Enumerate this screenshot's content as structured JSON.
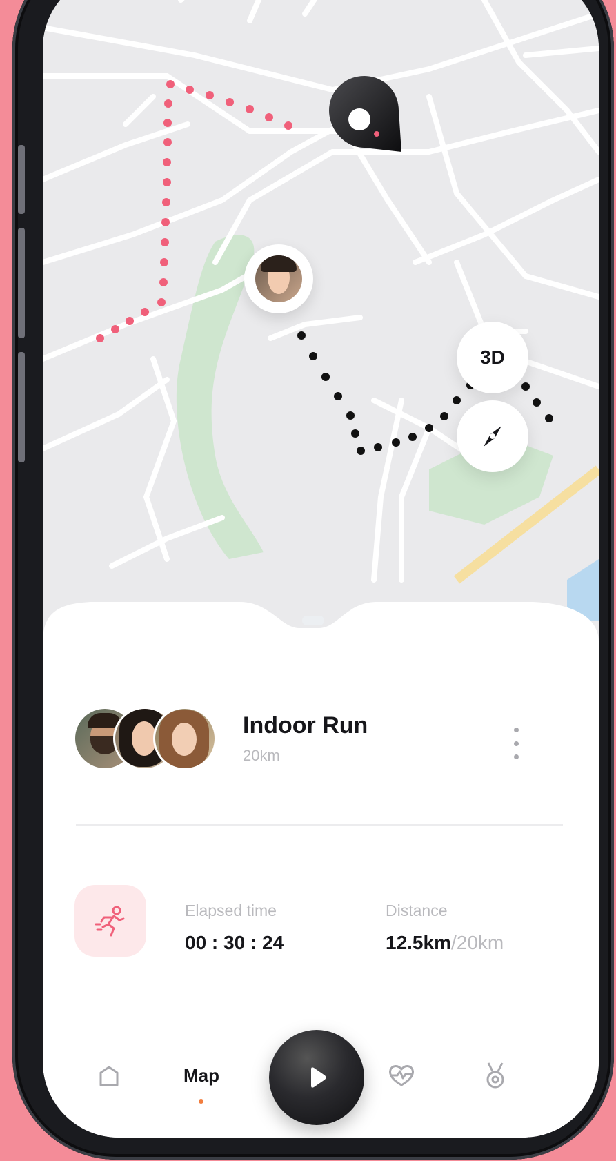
{
  "map": {
    "controls": {
      "view_3d_label": "3D",
      "compass_icon": "compass-icon"
    },
    "route_color_start": "#f0607a",
    "route_color_current": "#111111"
  },
  "activity": {
    "title": "Indoor Run",
    "distance_goal": "20km",
    "more_icon": "more-vertical-icon",
    "participants_count": 3
  },
  "stats": {
    "activity_icon": "running-icon",
    "elapsed_label": "Elapsed time",
    "elapsed_value": "00 : 30 : 24",
    "distance_label": "Distance",
    "distance_current": "12.5km",
    "distance_total": "/20km"
  },
  "nav": {
    "home_icon": "home-icon",
    "map_label": "Map",
    "play_icon": "play-icon",
    "health_icon": "heart-pulse-icon",
    "achievements_icon": "medal-icon",
    "active_indicator_color": "#f27d3e"
  },
  "colors": {
    "accent": "#f0607a",
    "background": "#f48c98",
    "park": "#cfe6cf",
    "road_highlight": "#f6dfa0"
  }
}
